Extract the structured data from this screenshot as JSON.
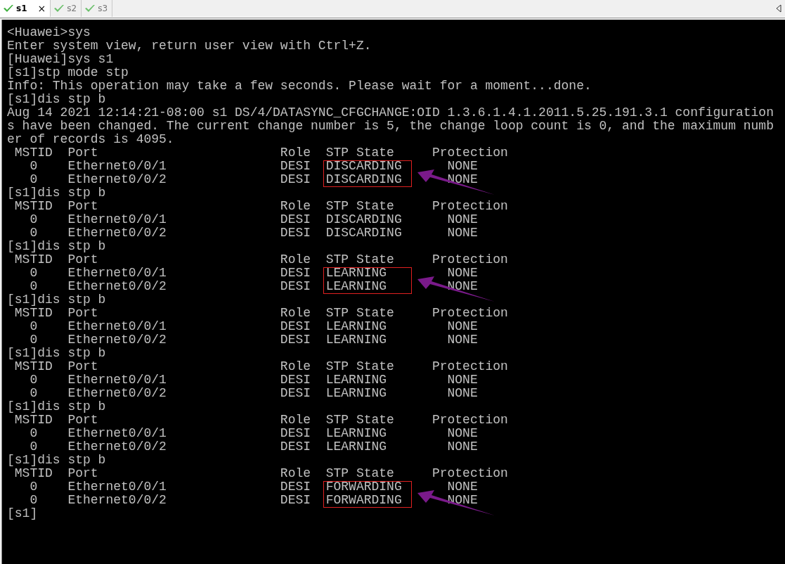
{
  "tabs": [
    {
      "label": "s1",
      "selected": true,
      "close": "×"
    },
    {
      "label": "s2",
      "selected": false
    },
    {
      "label": "s3",
      "selected": false
    }
  ],
  "terminal": {
    "lines": [
      {
        "text": "<Huawei>sys",
        "highlighted": false
      },
      {
        "text": "Enter system view, return user view with Ctrl+Z.",
        "highlighted": false
      },
      {
        "text": "[Huawei]sys s1",
        "highlighted": false
      },
      {
        "text": "[s1]stp mode stp",
        "highlighted": false
      },
      {
        "text": "Info: This operation may take a few seconds. Please wait for a moment...done.",
        "highlighted": false
      },
      {
        "text": "[s1]dis stp b",
        "highlighted": false
      },
      {
        "text": "Aug 14 2021 12:14:21-08:00 s1 DS/4/DATASYNC_CFGCHANGE:OID 1.3.6.1.4.1.2011.5.25.191.3.1 configuration",
        "highlighted": false
      },
      {
        "text": "s have been changed. The current change number is 5, the change loop count is 0, and the maximum numb",
        "highlighted": false
      },
      {
        "text": "er of records is 4095.",
        "highlighted": false
      },
      {
        "text": " MSTID  Port                        Role  STP State     Protection",
        "highlighted": false
      },
      {
        "text": "   0    Ethernet0/0/1               DESI  DISCARDING      NONE",
        "highlighted": true
      },
      {
        "text": "   0    Ethernet0/0/2               DESI  DISCARDING      NONE",
        "highlighted": true
      },
      {
        "text": "[s1]dis stp b",
        "highlighted": false
      },
      {
        "text": " MSTID  Port                        Role  STP State     Protection",
        "highlighted": false
      },
      {
        "text": "   0    Ethernet0/0/1               DESI  DISCARDING      NONE",
        "highlighted": false
      },
      {
        "text": "   0    Ethernet0/0/2               DESI  DISCARDING      NONE",
        "highlighted": false
      },
      {
        "text": "[s1]dis stp b",
        "highlighted": false
      },
      {
        "text": " MSTID  Port                        Role  STP State     Protection",
        "highlighted": false
      },
      {
        "text": "   0    Ethernet0/0/1               DESI  LEARNING        NONE",
        "highlighted": true
      },
      {
        "text": "   0    Ethernet0/0/2               DESI  LEARNING        NONE",
        "highlighted": true
      },
      {
        "text": "[s1]dis stp b",
        "highlighted": false
      },
      {
        "text": " MSTID  Port                        Role  STP State     Protection",
        "highlighted": false
      },
      {
        "text": "   0    Ethernet0/0/1               DESI  LEARNING        NONE",
        "highlighted": false
      },
      {
        "text": "   0    Ethernet0/0/2               DESI  LEARNING        NONE",
        "highlighted": false
      },
      {
        "text": "[s1]dis stp b",
        "highlighted": false
      },
      {
        "text": " MSTID  Port                        Role  STP State     Protection",
        "highlighted": false
      },
      {
        "text": "   0    Ethernet0/0/1               DESI  LEARNING        NONE",
        "highlighted": false
      },
      {
        "text": "   0    Ethernet0/0/2               DESI  LEARNING        NONE",
        "highlighted": false
      },
      {
        "text": "[s1]dis stp b",
        "highlighted": false
      },
      {
        "text": " MSTID  Port                        Role  STP State     Protection",
        "highlighted": false
      },
      {
        "text": "   0    Ethernet0/0/1               DESI  LEARNING        NONE",
        "highlighted": false
      },
      {
        "text": "   0    Ethernet0/0/2               DESI  LEARNING        NONE",
        "highlighted": false
      },
      {
        "text": "[s1]dis stp b",
        "highlighted": false
      },
      {
        "text": " MSTID  Port                        Role  STP State     Protection",
        "highlighted": false
      },
      {
        "text": "   0    Ethernet0/0/1               DESI  FORWARDING      NONE",
        "highlighted": true
      },
      {
        "text": "   0    Ethernet0/0/2               DESI  FORWARDING      NONE",
        "highlighted": true
      },
      {
        "text": "[s1]",
        "highlighted": false
      }
    ]
  }
}
